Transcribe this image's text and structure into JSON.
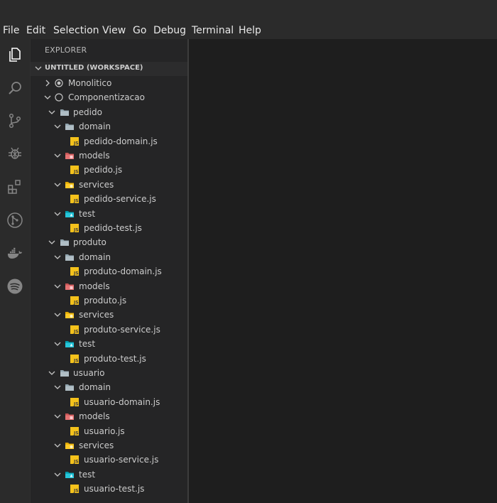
{
  "menu": {
    "file": "File",
    "edit": "Edit",
    "selection": "Selection",
    "view": "View",
    "go": "Go",
    "debug": "Debug",
    "terminal": "Terminal",
    "help": "Help"
  },
  "activity": {
    "explorer": "files-icon",
    "search": "search-icon",
    "scm": "source-control-icon",
    "debug": "debug-icon",
    "extensions": "extensions-icon",
    "git": "git-graph-icon",
    "docker": "docker-icon",
    "spotify": "spotify-icon"
  },
  "explorer": {
    "title": "EXPLORER",
    "workspace": "UNTITLED (WORKSPACE)"
  },
  "tree": {
    "monolitico": "Monolitico",
    "componentizacao": "Componentizacao",
    "pedido": {
      "name": "pedido",
      "domain": "domain",
      "domain_file": "pedido-domain.js",
      "models": "models",
      "models_file": "pedido.js",
      "services": "services",
      "services_file": "pedido-service.js",
      "test": "test",
      "test_file": "pedido-test.js"
    },
    "produto": {
      "name": "produto",
      "domain": "domain",
      "domain_file": "produto-domain.js",
      "models": "models",
      "models_file": "produto.js",
      "services": "services",
      "services_file": "produto-service.js",
      "test": "test",
      "test_file": "produto-test.js"
    },
    "usuario": {
      "name": "usuario",
      "domain": "domain",
      "domain_file": "usuario-domain.js",
      "models": "models",
      "models_file": "usuario.js",
      "services": "services",
      "services_file": "usuario-service.js",
      "test": "test",
      "test_file": "usuario-test.js"
    }
  },
  "colors": {
    "js_icon": "#f5c21b",
    "folder": "#90a4ae",
    "models_folder": "#e57373",
    "services_folder": "#ffca28",
    "test_folder": "#26c6da"
  }
}
